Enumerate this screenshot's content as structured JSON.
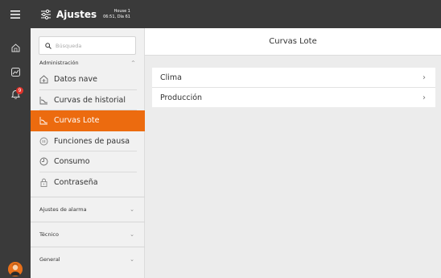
{
  "app": {
    "title": "Ajustes",
    "house": "House 1",
    "datetime": "06:51, Día 61"
  },
  "search": {
    "placeholder": "Búsqueda",
    "value": ""
  },
  "sidebar": {
    "section": "Administración",
    "items": [
      {
        "label": "Datos nave",
        "icon": "house-data-icon"
      },
      {
        "label": "Curvas de historial",
        "icon": "curve-icon"
      },
      {
        "label": "Curvas Lote",
        "icon": "curve-icon",
        "active": true
      },
      {
        "label": "Funciones de pausa",
        "icon": "pause-icon"
      },
      {
        "label": "Consumo",
        "icon": "gauge-icon"
      },
      {
        "label": "Contraseña",
        "icon": "lock-icon"
      }
    ],
    "groups": [
      {
        "label": "Ajustes de alarma"
      },
      {
        "label": "Técnico"
      },
      {
        "label": "General"
      }
    ]
  },
  "rail": {
    "icons": [
      "menu-icon",
      "house-icon",
      "chart-icon",
      "alarm-bell-icon",
      "user-avatar-icon"
    ],
    "alarm_count": "9"
  },
  "main": {
    "title": "Curvas Lote",
    "cards": [
      {
        "label": "Clima"
      },
      {
        "label": "Producción"
      }
    ]
  },
  "colors": {
    "accent": "#ec6b0f",
    "dark": "#3a3a3a",
    "alarm": "#e0332b"
  }
}
